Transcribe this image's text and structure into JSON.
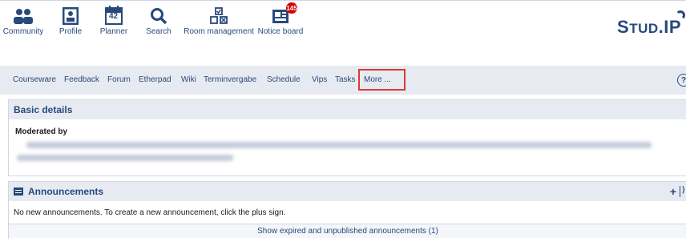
{
  "topnav": {
    "items": [
      {
        "label": "Community",
        "icon": "community-icon"
      },
      {
        "label": "Profile",
        "icon": "profile-icon"
      },
      {
        "label": "Planner",
        "icon": "planner-icon",
        "icon_text": "42"
      },
      {
        "label": "Search",
        "icon": "search-icon"
      },
      {
        "label": "Room management",
        "icon": "room-management-icon"
      },
      {
        "label": "Notice board",
        "icon": "notice-board-icon",
        "badge": "145"
      }
    ],
    "logo": {
      "main": "STUD.IP",
      "part1": "S",
      "part2": "TUD",
      "part3": ".IP"
    }
  },
  "subnav": {
    "items": [
      "Courseware",
      "Feedback",
      "Forum",
      "Etherpad",
      "Wiki",
      "Terminvergabe",
      "Schedule",
      "Vips",
      "Tasks",
      "More ..."
    ],
    "help_label": "?"
  },
  "basic_details": {
    "title": "Basic details",
    "moderated_by_label": "Moderated by"
  },
  "announcements": {
    "title": "Announcements",
    "empty_text": "No new announcements. To create a new announcement, click the plus sign.",
    "show_link": "Show expired and unpublished announcements (1)",
    "plus_label": "+"
  },
  "colors": {
    "accent": "#28497c",
    "highlight": "#d93a3a",
    "header_bg": "#e7ebf1",
    "badge": "#d60000"
  }
}
